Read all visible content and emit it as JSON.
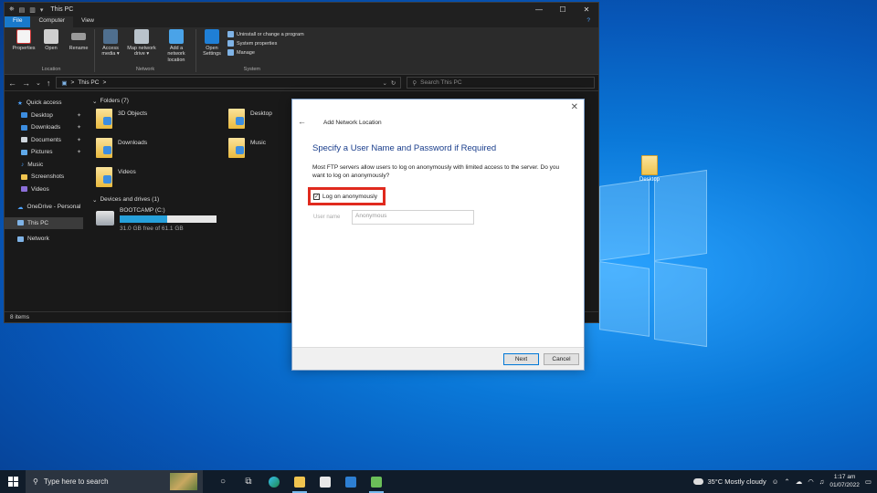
{
  "explorer": {
    "title": "This PC",
    "tabs": [
      "File",
      "Computer",
      "View"
    ],
    "ribbon": {
      "location": {
        "label": "Location",
        "buttons": [
          "Properties",
          "Open",
          "Rename"
        ]
      },
      "network": {
        "label": "Network",
        "buttons": [
          "Access media ▾",
          "Map network drive ▾",
          "Add a network location"
        ]
      },
      "system": {
        "label": "System",
        "open_settings": "Open Settings",
        "links": [
          "Uninstall or change a program",
          "System properties",
          "Manage"
        ]
      }
    },
    "address": "This PC",
    "address_sep": ">",
    "search_placeholder": "Search This PC",
    "sidebar": {
      "quick_access": "Quick access",
      "items": [
        "Desktop",
        "Downloads",
        "Documents",
        "Pictures",
        "Music",
        "Screenshots",
        "Videos"
      ],
      "onedrive": "OneDrive - Personal",
      "this_pc": "This PC",
      "network": "Network"
    },
    "folders_header": "Folders (7)",
    "folders": [
      "3D Objects",
      "Desktop",
      "Downloads",
      "Music",
      "Videos"
    ],
    "drives_header": "Devices and drives (1)",
    "drive": {
      "name": "BOOTCAMP (C:)",
      "free": "31.0 GB free of 61.1 GB",
      "used_fraction": 0.49
    },
    "status": "8 items"
  },
  "dialog": {
    "title": "Add Network Location",
    "heading": "Specify a User Name and Password if Required",
    "description": "Most FTP servers allow users to log on anonymously with limited access to the server.  Do you want to log on anonymously?",
    "checkbox_label": "Log on anonymously",
    "checkbox_mark": "✓",
    "username_label": "User name",
    "username_value": "Anonymous",
    "next": "Next",
    "cancel": "Cancel"
  },
  "desktop": {
    "icon_label": "Desktop"
  },
  "taskbar": {
    "search_placeholder": "Type here to search",
    "weather": "35°C  Mostly cloudy",
    "time": "1:17 am",
    "date": "01/07/2022"
  }
}
